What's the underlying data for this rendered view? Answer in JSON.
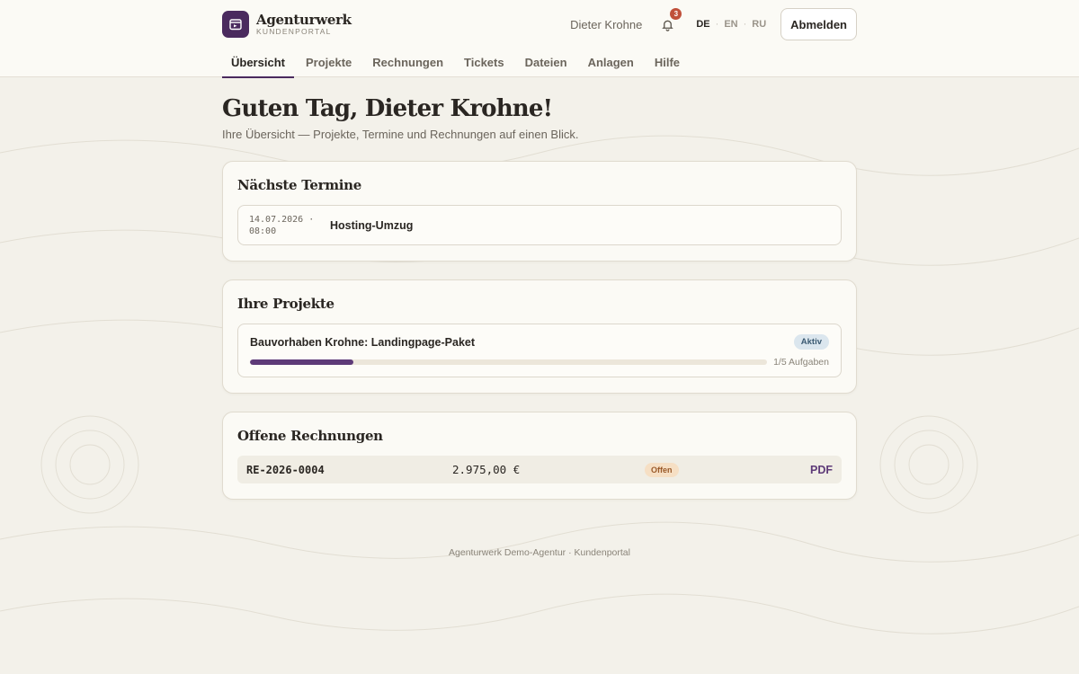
{
  "brand": {
    "name": "Agenturwerk",
    "subtitle": "KUNDENPORTAL",
    "accent": "#4a2a5e"
  },
  "header": {
    "user_name": "Dieter Krohne",
    "notifications_count": "3",
    "languages": [
      {
        "code": "DE",
        "active": true
      },
      {
        "code": "EN",
        "active": false
      },
      {
        "code": "RU",
        "active": false
      }
    ],
    "logout_label": "Abmelden"
  },
  "nav": {
    "items": [
      {
        "label": "Übersicht",
        "active": true
      },
      {
        "label": "Projekte",
        "active": false
      },
      {
        "label": "Rechnungen",
        "active": false
      },
      {
        "label": "Tickets",
        "active": false
      },
      {
        "label": "Dateien",
        "active": false
      },
      {
        "label": "Anlagen",
        "active": false
      },
      {
        "label": "Hilfe",
        "active": false
      }
    ]
  },
  "main": {
    "greeting": "Guten Tag, Dieter Krohne!",
    "subtitle": "Ihre Übersicht — Projekte, Termine und Rechnungen auf einen Blick.",
    "appointments": {
      "title": "Nächste Termine",
      "items": [
        {
          "date": "14.07.2026 ·",
          "time": "08:00",
          "title": "Hosting-Umzug"
        }
      ]
    },
    "projects": {
      "title": "Ihre Projekte",
      "items": [
        {
          "name": "Bauvorhaben Krohne: Landingpage-Paket",
          "status": "Aktiv",
          "progress": 0.2,
          "tasks": "1/5 Aufgaben"
        }
      ]
    },
    "invoices": {
      "title": "Offene Rechnungen",
      "items": [
        {
          "number": "RE-2026-0004",
          "amount": "2.975,00 €",
          "status": "Offen",
          "pdf_label": "PDF"
        }
      ]
    }
  },
  "footer": {
    "text": "Agenturwerk Demo-Agentur · Kundenportal"
  }
}
